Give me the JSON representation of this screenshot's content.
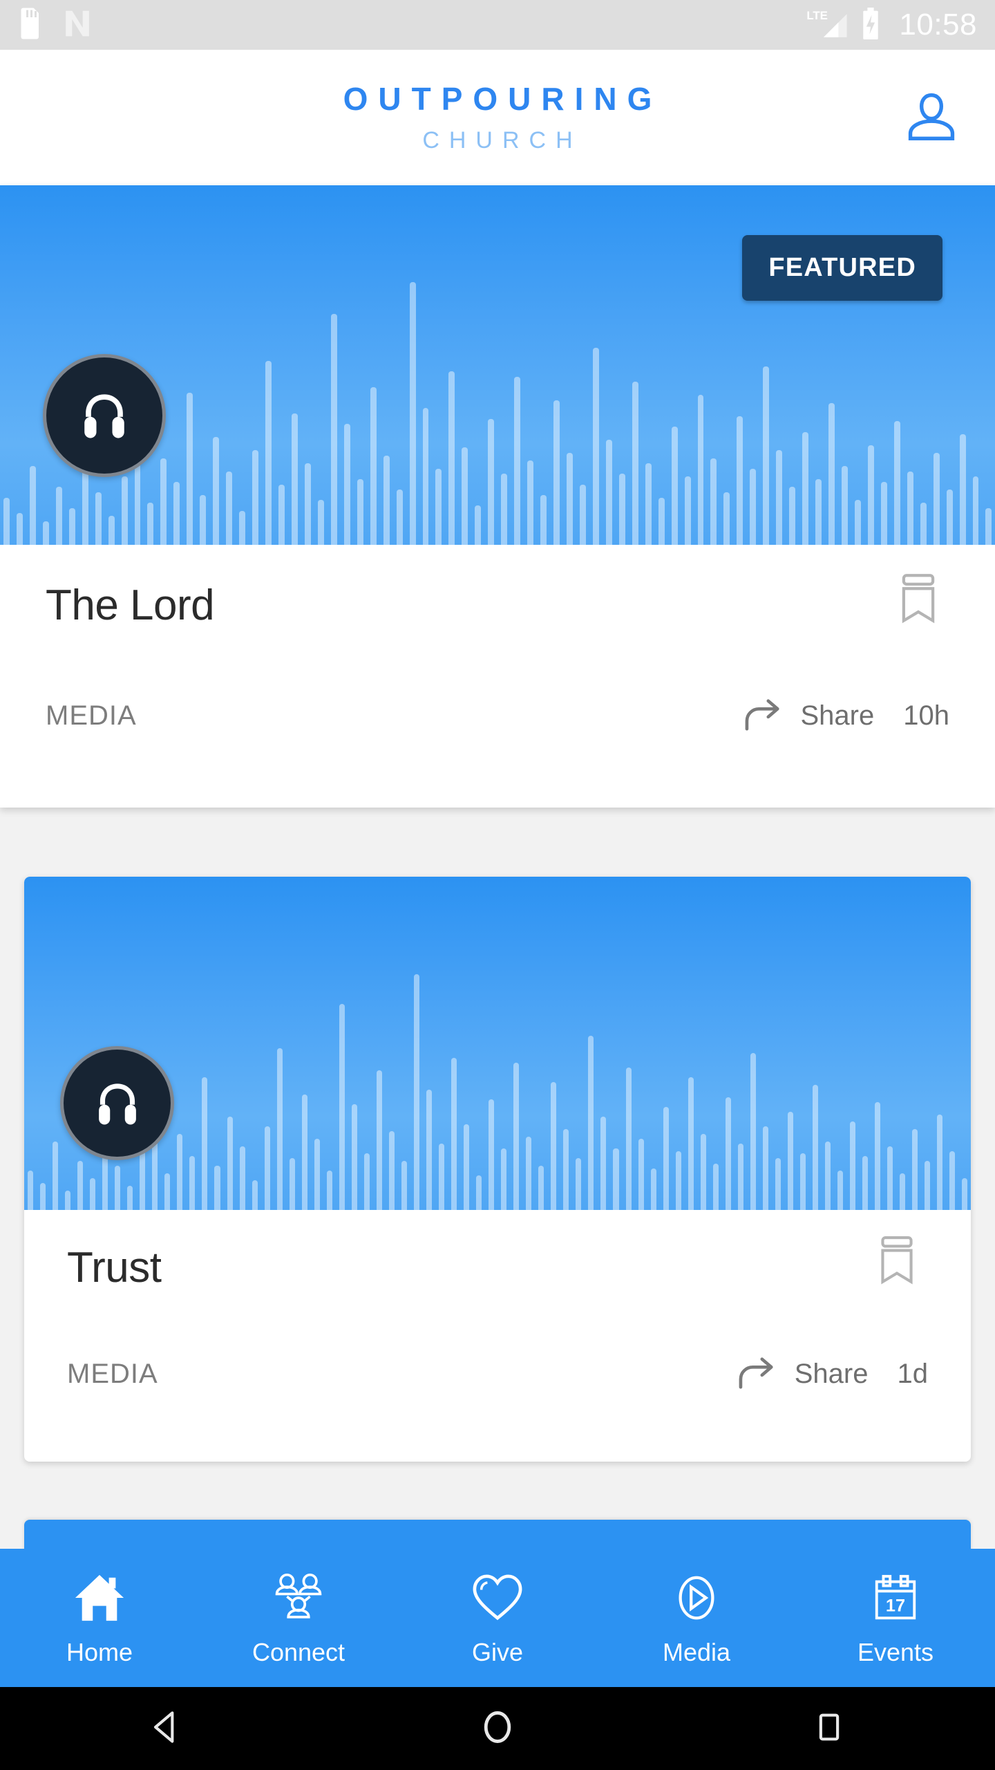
{
  "status_bar": {
    "time": "10:58",
    "icons_left": [
      "sd-card-icon",
      "android-nougat-icon"
    ],
    "icons_right": [
      "lte-signal-icon",
      "battery-charging-icon"
    ],
    "network_label": "LTE",
    "background_color": "#dedede"
  },
  "header": {
    "logo_main": "OUTPOURING",
    "logo_sub": "CHURCH",
    "logo_color": "#2e86f0",
    "logo_sub_color": "#8cc0f5",
    "profile_icon": "person-icon"
  },
  "featured": {
    "badge_label": "FEATURED",
    "badge_bg": "#18436d",
    "media_icon": "headphones-icon",
    "title": "The Lord",
    "kind": "MEDIA",
    "share_label": "Share",
    "age": "10h",
    "bookmark_icon": "bookmark-icon",
    "share_icon": "share-arrow-icon",
    "hero_color": "#2c92f2"
  },
  "card2": {
    "media_icon": "headphones-icon",
    "title": "Trust",
    "kind": "MEDIA",
    "share_label": "Share",
    "age": "1d",
    "bookmark_icon": "bookmark-icon",
    "share_icon": "share-arrow-icon"
  },
  "bottom_nav": {
    "accent_color": "#2c92f2",
    "items": [
      {
        "label": "Home",
        "icon": "home-icon",
        "active": true
      },
      {
        "label": "Connect",
        "icon": "people-icon",
        "active": false
      },
      {
        "label": "Give",
        "icon": "heart-icon",
        "active": false
      },
      {
        "label": "Media",
        "icon": "play-circle-icon",
        "active": false
      },
      {
        "label": "Events",
        "icon": "calendar-icon",
        "active": false
      }
    ],
    "calendar_day": "17"
  },
  "system_nav": {
    "back_icon": "back-triangle-icon",
    "home_icon": "home-circle-icon",
    "recents_icon": "recents-square-icon"
  },
  "waveform": {
    "featured_bars": [
      18,
      12,
      30,
      9,
      22,
      14,
      38,
      20,
      11,
      26,
      44,
      16,
      33,
      24,
      58,
      19,
      41,
      28,
      13,
      36,
      70,
      23,
      50,
      31,
      17,
      88,
      46,
      25,
      60,
      34,
      21,
      100,
      52,
      29,
      66,
      37,
      15,
      48,
      27,
      64,
      32,
      19,
      55,
      35,
      23,
      75,
      40,
      27,
      62,
      31,
      18,
      45,
      26,
      57,
      33,
      20,
      49,
      29,
      68,
      36,
      22,
      43,
      25,
      54,
      30,
      17,
      38,
      24,
      47,
      28,
      16,
      35,
      21,
      42,
      26,
      14
    ],
    "card2_bars": [
      16,
      11,
      28,
      8,
      20,
      13,
      35,
      18,
      10,
      24,
      41,
      15,
      31,
      22,
      54,
      18,
      38,
      26,
      12,
      34,
      66,
      21,
      47,
      29,
      16,
      84,
      43,
      23,
      57,
      32,
      20,
      96,
      49,
      27,
      62,
      35,
      14,
      45,
      25,
      60,
      30,
      18,
      52,
      33,
      21,
      71,
      38,
      25,
      58,
      29,
      17,
      42,
      24,
      54,
      31,
      19,
      46,
      27,
      64,
      34,
      21,
      40,
      23,
      51,
      28,
      16,
      36,
      22,
      44,
      26,
      15,
      33,
      20,
      39,
      24,
      13
    ]
  }
}
